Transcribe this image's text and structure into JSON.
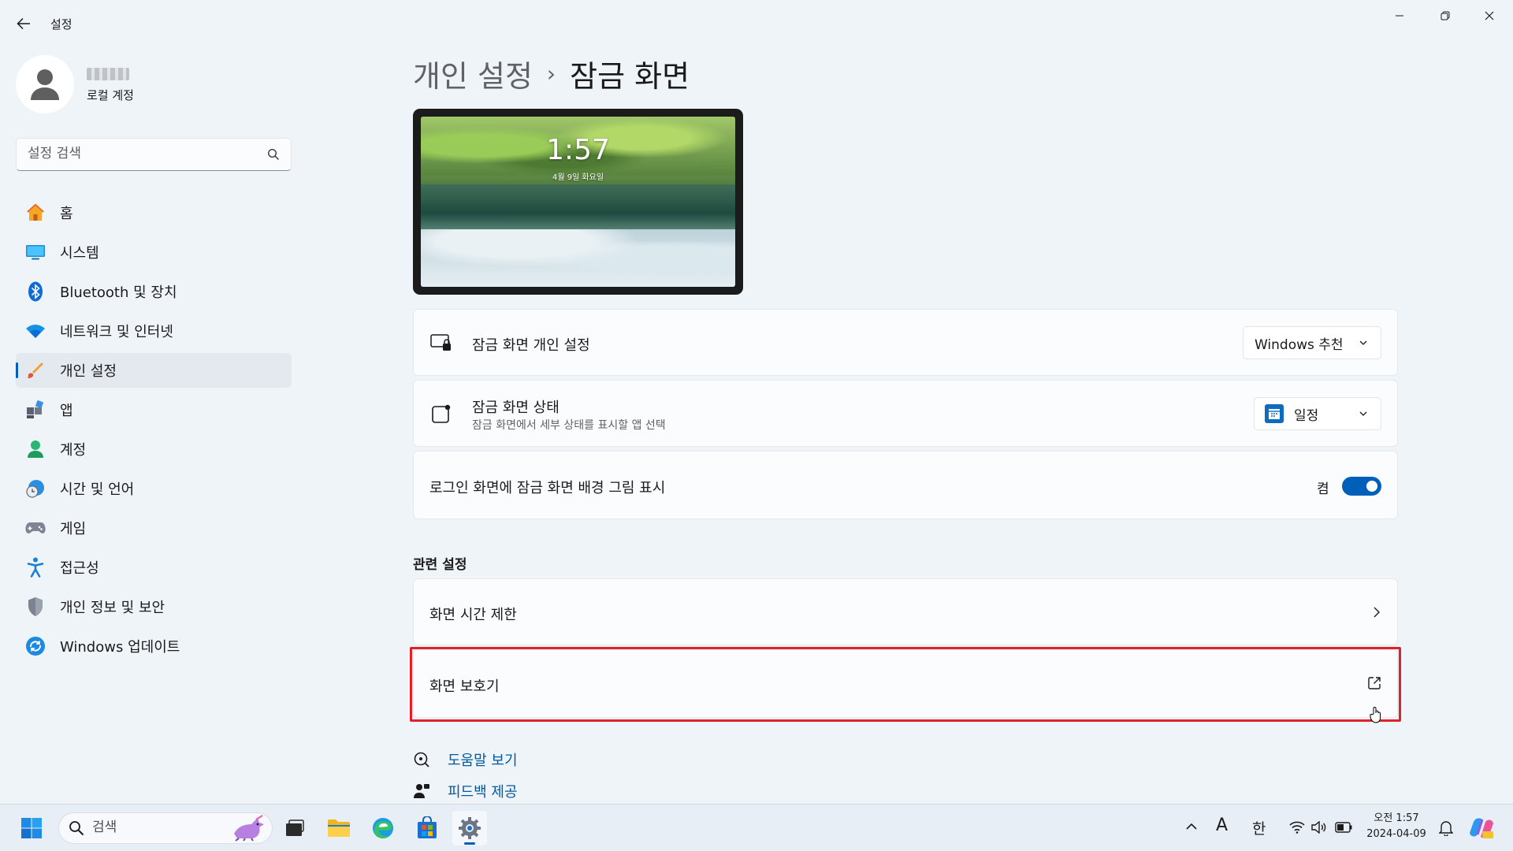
{
  "window": {
    "title": "설정"
  },
  "user": {
    "account_type": "로컬 계정"
  },
  "search": {
    "placeholder": "설정 검색"
  },
  "nav": {
    "items": [
      {
        "label": "홈",
        "icon": "home-icon"
      },
      {
        "label": "시스템",
        "icon": "system-icon"
      },
      {
        "label": "Bluetooth 및 장치",
        "icon": "bluetooth-icon"
      },
      {
        "label": "네트워크 및 인터넷",
        "icon": "wifi-icon"
      },
      {
        "label": "개인 설정",
        "icon": "brush-icon",
        "active": true
      },
      {
        "label": "앱",
        "icon": "apps-icon"
      },
      {
        "label": "계정",
        "icon": "person-icon"
      },
      {
        "label": "시간 및 언어",
        "icon": "globe-clock-icon"
      },
      {
        "label": "게임",
        "icon": "gamepad-icon"
      },
      {
        "label": "접근성",
        "icon": "accessibility-icon"
      },
      {
        "label": "개인 정보 및 보안",
        "icon": "shield-icon"
      },
      {
        "label": "Windows 업데이트",
        "icon": "update-icon"
      }
    ]
  },
  "breadcrumb": {
    "parent": "개인 설정",
    "separator": "›",
    "current": "잠금 화면"
  },
  "preview": {
    "time": "1:57",
    "date": "4월 9일 화요일"
  },
  "settings": {
    "personalize": {
      "title": "잠금 화면 개인 설정",
      "value": "Windows 추천"
    },
    "status": {
      "title": "잠금 화면 상태",
      "subtitle": "잠금 화면에서 세부 상태를 표시할 앱 선택",
      "value": "일정"
    },
    "signin_bg": {
      "title": "로그인 화면에 잠금 화면 배경 그림 표시",
      "state_label": "켬",
      "on": true
    }
  },
  "related": {
    "heading": "관련 설정",
    "screen_timeout": {
      "title": "화면 시간 제한"
    },
    "screen_saver": {
      "title": "화면 보호기"
    }
  },
  "links": {
    "help": "도움말 보기",
    "feedback": "피드백 제공"
  },
  "taskbar": {
    "search_placeholder": "검색",
    "ime_a": "A",
    "ime_lang": "한",
    "clock_time": "오전 1:57",
    "clock_date": "2024-04-09"
  },
  "colors": {
    "accent": "#005fb8",
    "highlight": "#e0202a",
    "link": "#005a9e"
  }
}
